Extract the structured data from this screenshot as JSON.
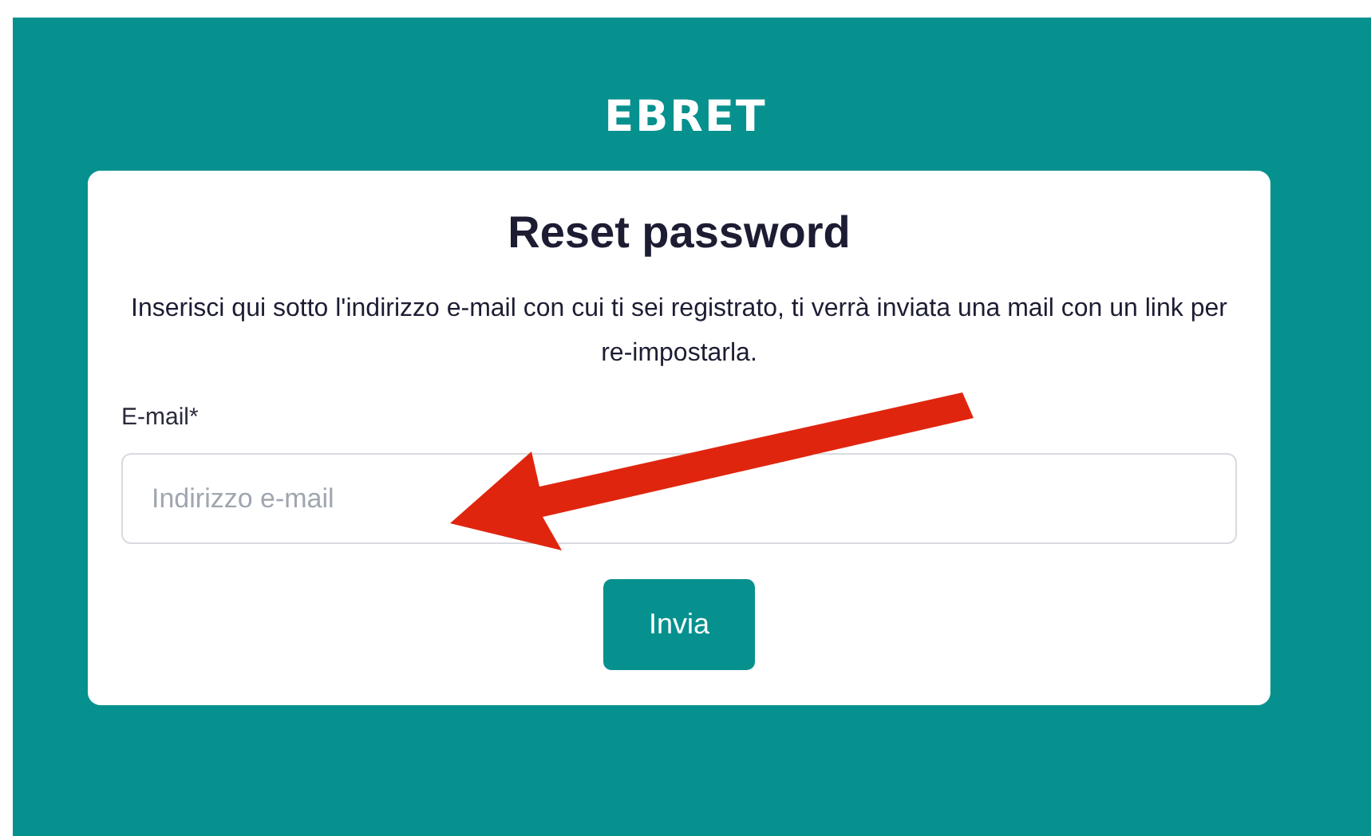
{
  "logo": "EBRET",
  "title": "Reset password",
  "description": "Inserisci qui sotto l'indirizzo e-mail con cui ti sei registrato, ti verrà inviata una mail con un link per re-impostarla.",
  "email_field": {
    "label": "E-mail*",
    "placeholder": "Indirizzo e-mail"
  },
  "submit_button": "Invia"
}
